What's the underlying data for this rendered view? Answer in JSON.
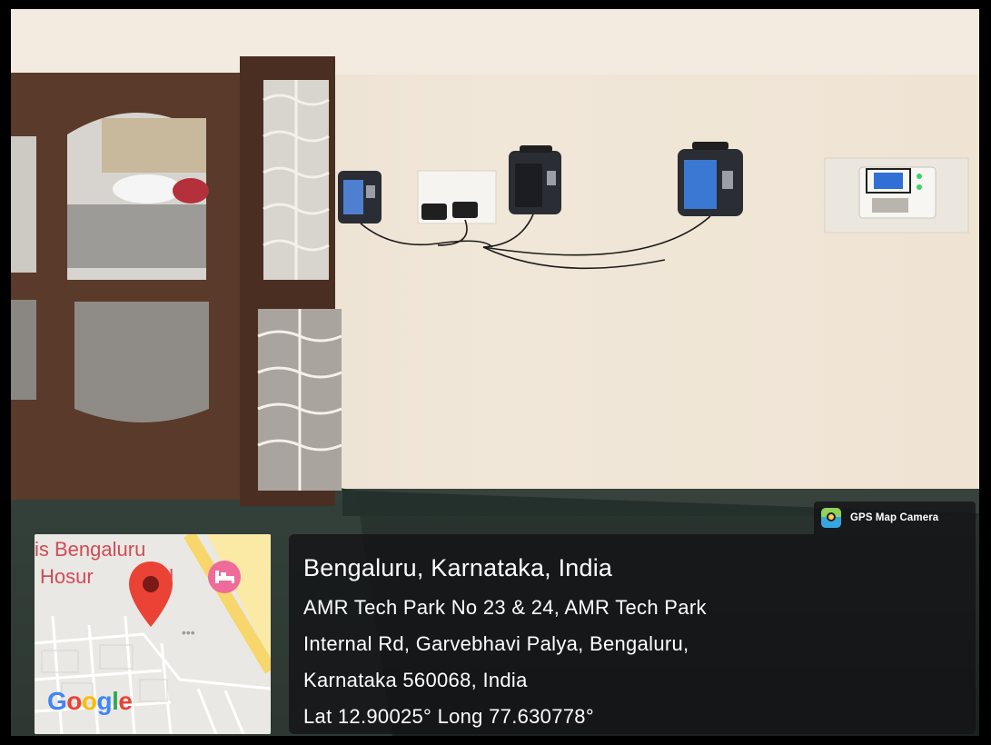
{
  "badge": {
    "app_name": "GPS Map Camera",
    "icon": "gps-map-camera-app-icon"
  },
  "location": {
    "title": "Bengaluru, Karnataka, India",
    "address_line1": "AMR Tech Park No 23 & 24, AMR Tech Park",
    "address_line2": "Internal Rd, Garvebhavi Palya, Bengaluru,",
    "address_line3": "Karnataka 560068, India",
    "coordinates": "Lat 12.90025° Long 77.630778°"
  },
  "map": {
    "label_line1": "is Bengaluru",
    "label_line2": "Hosur",
    "label_line2_tail": "d",
    "logo": {
      "G": "G",
      "o1": "o",
      "o2": "o",
      "g": "g",
      "l": "l",
      "e": "e"
    },
    "pin_icon": "location-pin-icon",
    "hotel_icon": "hotel-bed-icon"
  },
  "colors": {
    "overlay": "#141416",
    "pin": "#ea4335",
    "wall": "#efe6d8",
    "door_wood": "#5a3a2a"
  }
}
